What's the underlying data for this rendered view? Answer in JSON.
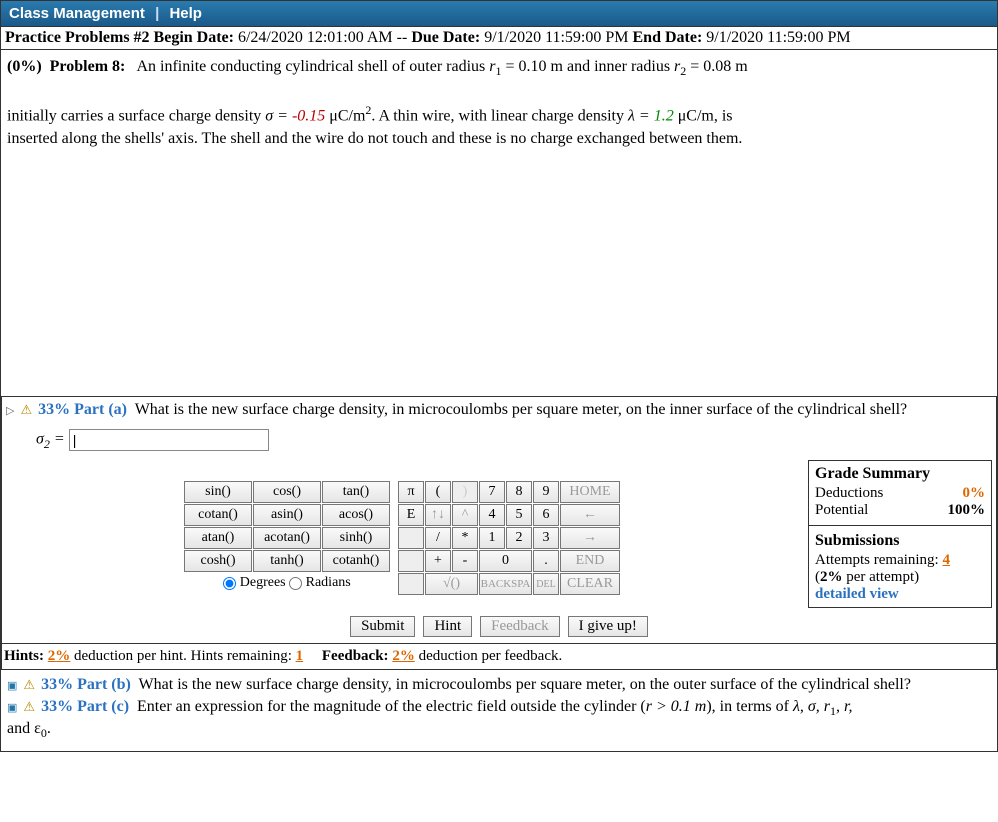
{
  "header": {
    "classMgmt": "Class Management",
    "help": "Help"
  },
  "dates": {
    "practiceLabel": "Practice Problems #2 Begin Date:",
    "begin": "6/24/2020 12:01:00 AM",
    "dueLabel": "Due Date:",
    "due": "9/1/2020 11:59:00 PM",
    "endLabel": "End Date:",
    "end": "9/1/2020 11:59:00 PM",
    "dashes": "--"
  },
  "problem": {
    "pct": "(0%)",
    "name": "Problem 8:",
    "text1": "An infinite conducting cylindrical shell of outer radius ",
    "r1var": "r",
    "r1sub": "1",
    "r1eq": " = 0.10 m and inner radius ",
    "r2var": "r",
    "r2sub": "2",
    "r2eq": " = 0.08 m",
    "text2": "initially carries a surface charge density ",
    "sigma": "σ = ",
    "sigmaVal": "-0.15",
    "unitsSigma": " μC/m",
    "sq": "2",
    "text3": ". A thin wire, with linear charge density ",
    "lambda": "λ = ",
    "lambdaVal": "1.2",
    "unitsLambda": " μC/m, is",
    "text4": "inserted along the shells' axis. The shell and the wire do not touch and these is no charge exchanged between them."
  },
  "partA": {
    "pct": "33%",
    "label": "Part (a)",
    "question": "What is the new surface charge density, in microcoulombs per square meter, on the inner surface of the cylindrical shell?",
    "answerVar": "σ",
    "answerSub": "2",
    "eq": " = "
  },
  "funcs": [
    [
      "sin()",
      "cos()",
      "tan()"
    ],
    [
      "cotan()",
      "asin()",
      "acos()"
    ],
    [
      "atan()",
      "acotan()",
      "sinh()"
    ],
    [
      "cosh()",
      "tanh()",
      "cotanh()"
    ]
  ],
  "angleMode": {
    "deg": "Degrees",
    "rad": "Radians"
  },
  "numpad": {
    "r1": [
      "π",
      "(",
      ")",
      "7",
      "8",
      "9",
      "HOME"
    ],
    "r2": [
      "E",
      "↑↓",
      "^",
      "4",
      "5",
      "6",
      "←"
    ],
    "r3": [
      "",
      "/",
      "*",
      "1",
      "2",
      "3",
      "→"
    ],
    "r4": [
      "",
      "+",
      "-",
      "0",
      ".",
      "END"
    ],
    "r5": [
      "",
      "√()",
      "BACKSPA",
      "DEL",
      "CLEAR"
    ]
  },
  "grade": {
    "title": "Grade Summary",
    "dedLabel": "Deductions",
    "dedVal": "0%",
    "potLabel": "Potential",
    "potVal": "100%",
    "subTitle": "Submissions",
    "attemptsLabel": "Attempts remaining: ",
    "attemptsVal": "4",
    "perAttempt": "(",
    "perAttemptPct": "2%",
    "perAttemptRest": " per attempt)",
    "detailed": "detailed view"
  },
  "actions": {
    "submit": "Submit",
    "hint": "Hint",
    "feedback": "Feedback",
    "giveup": "I give up!"
  },
  "hints": {
    "hLabel": "Hints:",
    "hPct": "2%",
    "hText": " deduction per hint. Hints remaining: ",
    "hRemain": "1",
    "fLabel": "Feedback:",
    "fPct": "2%",
    "fText": " deduction per feedback."
  },
  "partB": {
    "pct": "33%",
    "label": "Part (b)",
    "question": "What is the new surface charge density, in microcoulombs per square meter, on the outer surface of the cylindrical shell?"
  },
  "partC": {
    "pct": "33%",
    "label": "Part (c)",
    "q1": "Enter an expression for the magnitude of the electric field outside the cylinder (",
    "rexpr": "r > 0.1 m",
    "q2": "), in terms of ",
    "vars": "λ, σ, r",
    "v1sub": "1",
    "vrest": ", r,",
    "q3": "and ε",
    "epsSub": "0",
    "dot": "."
  }
}
